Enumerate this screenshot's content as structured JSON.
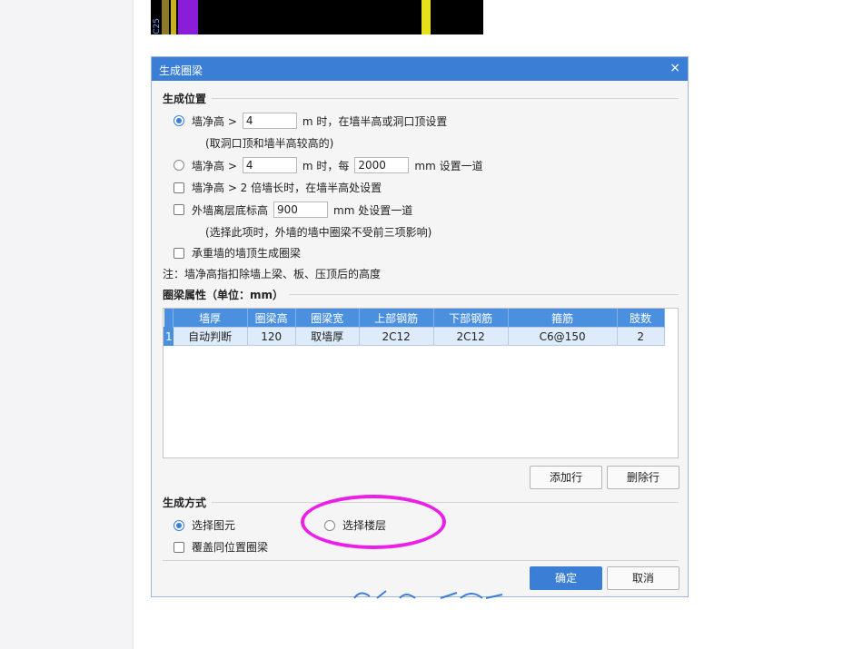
{
  "cad_preview": {
    "label": "C25"
  },
  "dialog": {
    "title": "生成圈梁",
    "close_glyph": "×",
    "position_section": {
      "title": "生成位置",
      "opt1": {
        "prefix": "墙净高 >",
        "value": "4",
        "suffix": "m 时，在墙半高或洞口顶设置",
        "note": "(取洞口顶和墙半高较高的)",
        "selected": true
      },
      "opt2": {
        "prefix": "墙净高 >",
        "value": "4",
        "mid": "m 时，每",
        "value2": "2000",
        "suffix": "mm 设置一道",
        "selected": false
      },
      "opt3": {
        "label": "墙净高 > 2 倍墙长时，在墙半高处设置",
        "checked": false
      },
      "opt4": {
        "prefix": "外墙离层底标高",
        "value": "900",
        "suffix": "mm 处设置一道",
        "note": "(选择此项时，外墙的墙中圈梁不受前三项影响)",
        "checked": false
      },
      "opt5": {
        "label": "承重墙的墙顶生成圈梁",
        "checked": false
      },
      "note": "注：墙净高指扣除墙上梁、板、压顶后的高度"
    },
    "props_section": {
      "title": "圈梁属性（单位：mm）",
      "columns": [
        "墙厚",
        "圈梁高",
        "圈梁宽",
        "上部钢筋",
        "下部钢筋",
        "箍筋",
        "肢数"
      ],
      "rows": [
        {
          "index": "1",
          "cells": [
            "自动判断",
            "120",
            "取墙厚",
            "2C12",
            "2C12",
            "C6@150",
            "2"
          ]
        }
      ],
      "add_row_label": "添加行",
      "delete_row_label": "删除行"
    },
    "method_section": {
      "title": "生成方式",
      "select_element": {
        "label": "选择图元",
        "selected": true
      },
      "select_floor": {
        "label": "选择楼层",
        "selected": false
      },
      "overwrite": {
        "label": "覆盖同位置圈梁",
        "checked": false
      }
    },
    "ok_label": "确定",
    "cancel_label": "取消"
  },
  "annotation": {
    "highlight_color": "#ec1fe8"
  },
  "colors": {
    "accent": "#3a7fd5",
    "header": "#4a90de"
  }
}
